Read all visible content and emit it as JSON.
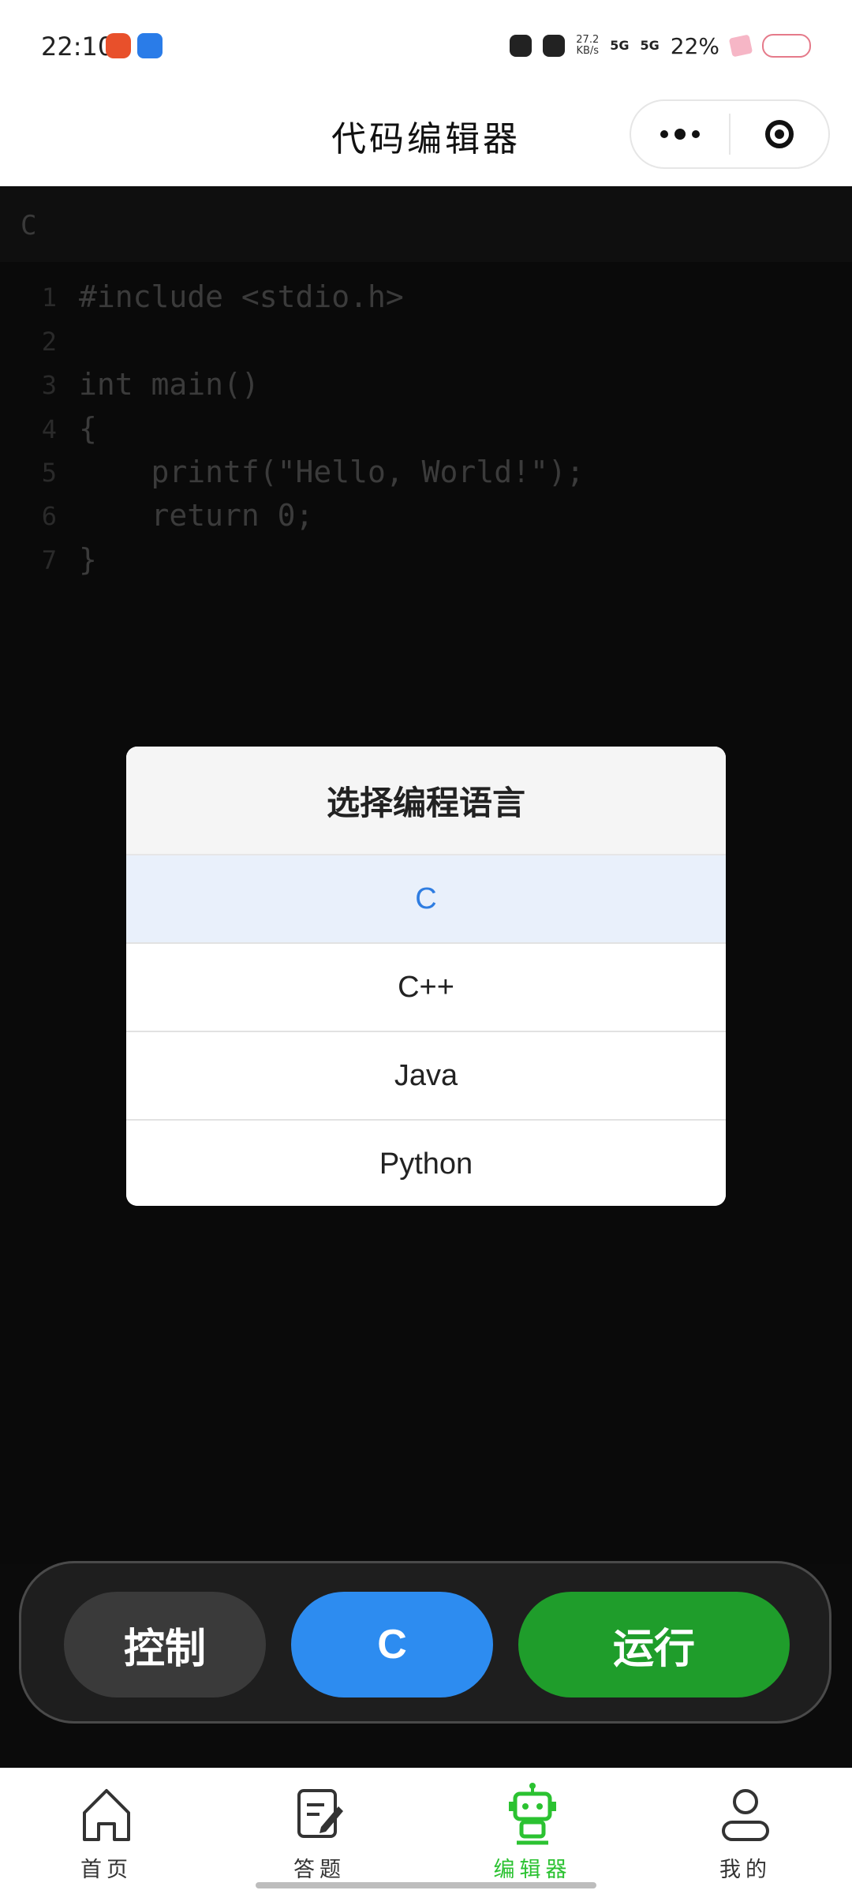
{
  "status_bar": {
    "time": "22:10",
    "net_speed_value": "27.2",
    "net_speed_unit": "KB/s",
    "signal_1": "5G",
    "signal_2": "5G",
    "battery": "22%"
  },
  "title_bar": {
    "title": "代码编辑器",
    "more_icon": "more-dots-icon",
    "target_icon": "target-circle-icon"
  },
  "editor": {
    "language": "C",
    "lines": [
      {
        "num": "1",
        "text": "#include <stdio.h>"
      },
      {
        "num": "2",
        "text": ""
      },
      {
        "num": "3",
        "text": "int main()"
      },
      {
        "num": "4",
        "text": "{"
      },
      {
        "num": "5",
        "text": "    printf(\"Hello, World!\");"
      },
      {
        "num": "6",
        "text": "    return 0;"
      },
      {
        "num": "7",
        "text": "}"
      }
    ]
  },
  "modal": {
    "title": "选择编程语言",
    "options": [
      "C",
      "C++",
      "Java",
      "Python"
    ],
    "selected": "C",
    "selected_color": "#2f7de1"
  },
  "actions": {
    "control_label": "控制",
    "language_label": "C",
    "run_label": "运行",
    "colors": {
      "control": "#3a3a3a",
      "language": "#2d8cf0",
      "run": "#1f9d2b"
    }
  },
  "tab_bar": {
    "items": [
      {
        "label": "首页",
        "icon": "home-icon",
        "active": false
      },
      {
        "label": "答题",
        "icon": "pencil-note-icon",
        "active": false
      },
      {
        "label": "编辑器",
        "icon": "robot-icon",
        "active": true
      },
      {
        "label": "我的",
        "icon": "person-icon",
        "active": false
      }
    ],
    "active_color": "#2bc231"
  }
}
